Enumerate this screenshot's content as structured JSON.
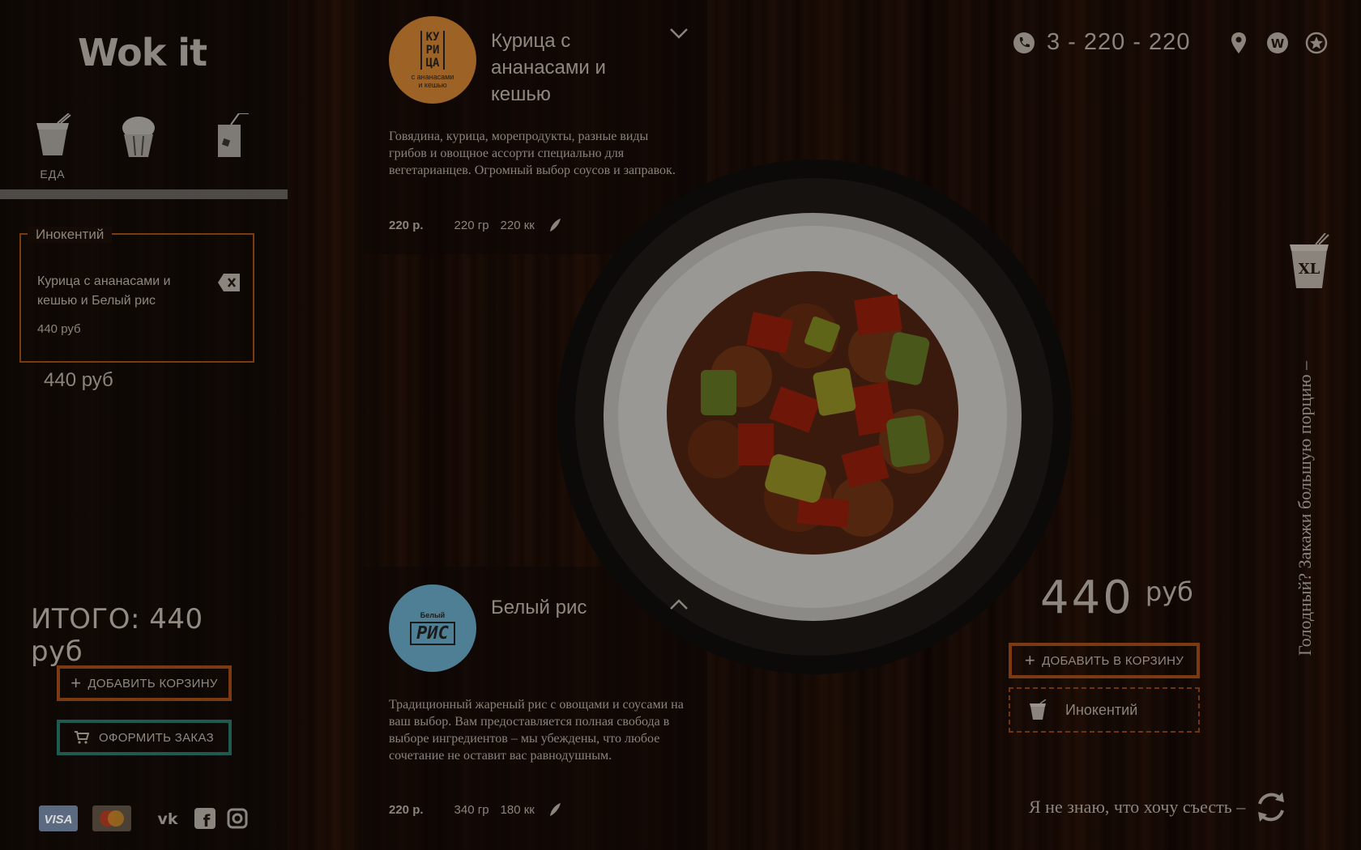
{
  "brand": {
    "logo_text": "Wok it"
  },
  "categories": [
    {
      "icon": "noodle-box-icon",
      "label": "ЕДА"
    },
    {
      "icon": "cupcake-icon",
      "label": ""
    },
    {
      "icon": "drink-icon",
      "label": ""
    }
  ],
  "order": {
    "guest_name": "Инокентий",
    "item_name": "Курица с ананасами и кешью и Белый рис",
    "item_price": "440 руб",
    "subtotal": "440 руб",
    "total": "ИТОГО: 440 руб",
    "add_basket_label": "ДОБАВИТЬ КОРЗИНУ",
    "checkout_label": "ОФОРМИТЬ ЗАКАЗ"
  },
  "payments": [
    "visa-icon",
    "mastercard-icon"
  ],
  "social": [
    "vk-icon",
    "facebook-icon",
    "instagram-icon"
  ],
  "dishes": [
    {
      "badge_text": "КУ РИ ЦА",
      "badge_sub": "с ананасами и кешью",
      "title": "Курица с ананасами и кешью",
      "description": "Говядина, курица, морепродукты, разные виды грибов и овощное ассорти специально для вегетарианцев. Огромный выбор соусов и заправок.",
      "price": "220 р.",
      "weight": "220 гр",
      "kcal": "220 кк"
    },
    {
      "badge_text": "РИС",
      "badge_sub": "Белый",
      "title": "Белый рис",
      "description": "Традиционный жареный рис с овощами и соусами на ваш выбор. Вам предоставляется полная свобода в выборе ингредиентов – мы убеждены, что любое сочетание не оставит вас равнодушным.",
      "price": "220 р.",
      "weight": "340 гр",
      "kcal": "180 кк"
    }
  ],
  "contacts": {
    "phone": "3 - 220 - 220"
  },
  "right": {
    "price_number": "440",
    "price_currency": "руб",
    "add_to_cart_label": "ДОБАВИТЬ В КОРЗИНУ",
    "guest_name": "Инокентий",
    "vertical_text": "Голодный? Закажи большую порцию –",
    "xl_label": "XL",
    "random_text": "Я не знаю, что хочу съесть –"
  }
}
